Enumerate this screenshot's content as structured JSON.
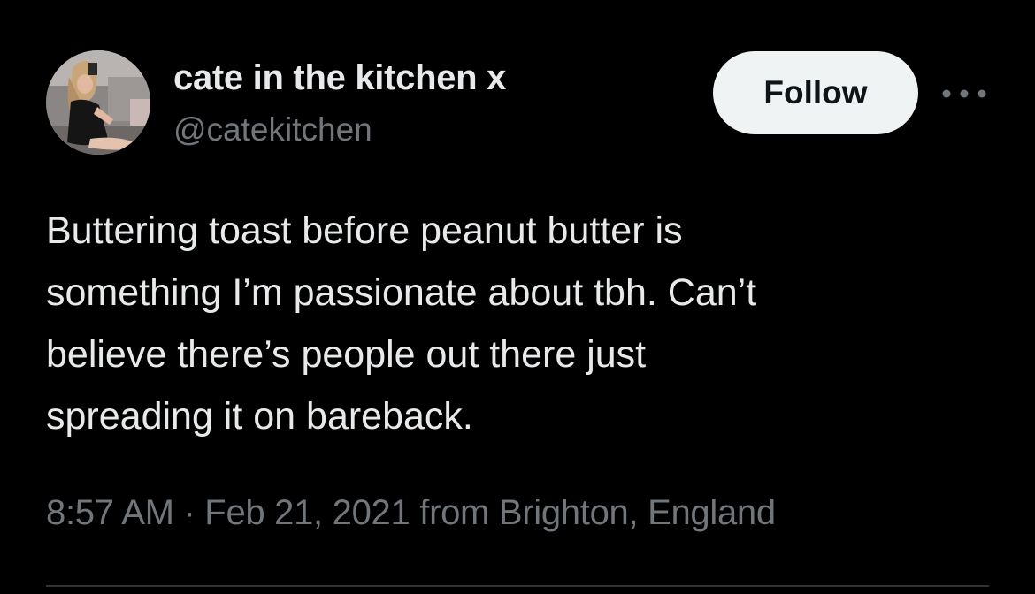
{
  "tweet": {
    "display_name": "cate in the kitchen x",
    "handle": "@catekitchen",
    "follow_label": "Follow",
    "text": "Buttering toast before peanut butter is\nsomething I’m passionate about tbh. Can’t\nbelieve there’s people out there just\nspreading it on bareback.",
    "meta": "8:57 AM · Feb 21, 2021 from Brighton, England"
  },
  "icons": {
    "more": "more-horizontal-icon",
    "avatar": "profile-photo"
  },
  "colors": {
    "background": "#000000",
    "primary_text": "#e7e9ea",
    "secondary_text": "#71767b",
    "follow_button_bg": "#eff3f4",
    "follow_button_text": "#0f1419",
    "divider": "#2f3336"
  }
}
